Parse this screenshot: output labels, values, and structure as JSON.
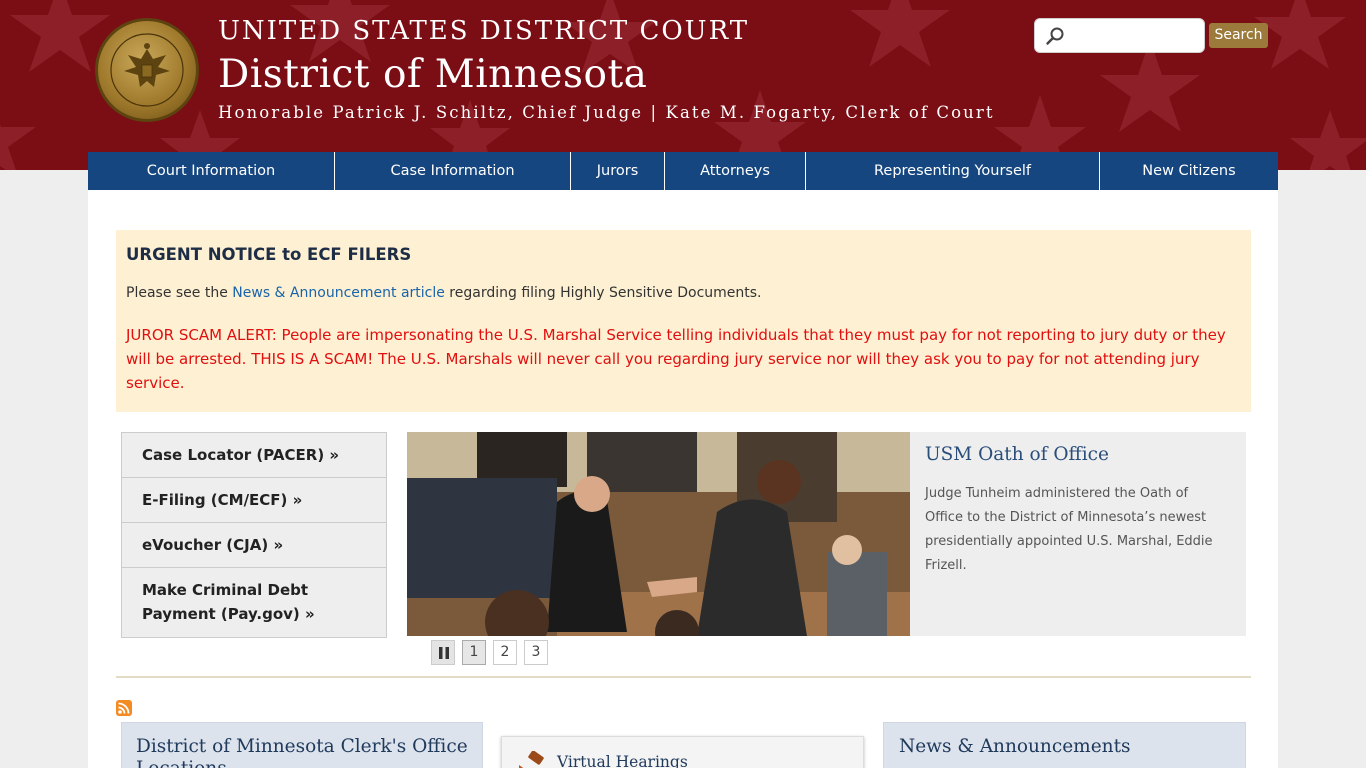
{
  "header": {
    "court_line": "UNITED STATES DISTRICT COURT",
    "district": "District of Minnesota",
    "officers": "Honorable Patrick J. Schiltz, Chief Judge | Kate M. Fogarty, Clerk of Court",
    "seal_text_top": "UNITED STATES DISTRICT COURT",
    "seal_text_bottom": "DISTRICT OF MINNESOTA",
    "background_color": "#7b0d15",
    "search": {
      "placeholder": "",
      "value": "",
      "button_label": "Search",
      "icon": "search-icon"
    }
  },
  "nav": {
    "items": [
      {
        "label": "Court Information"
      },
      {
        "label": "Case Information"
      },
      {
        "label": "Jurors"
      },
      {
        "label": "Attorneys"
      },
      {
        "label": "Representing Yourself"
      },
      {
        "label": "New Citizens"
      }
    ],
    "color": "#15467f"
  },
  "notice": {
    "title": "URGENT NOTICE to ECF FILERS",
    "text_before": "Please see the ",
    "link": "News & Announcement article",
    "text_after": " regarding filing Highly Sensitive Documents.",
    "alert": "JUROR SCAM ALERT: People are impersonating the U.S. Marshal Service telling individuals that they must pay for not reporting to jury duty or they will be arrested.  THIS IS A SCAM!  The U.S. Marshals will never call you regarding jury service nor will they ask you to pay for not attending jury service.",
    "alert_color": "#e10f0f"
  },
  "quick_links": [
    {
      "label": "Case Locator (PACER) »"
    },
    {
      "label": "E-Filing (CM/ECF) »"
    },
    {
      "label": "eVoucher (CJA) »"
    },
    {
      "label": "Make Criminal Debt Payment (Pay.gov) »"
    }
  ],
  "slideshow": {
    "title": "USM Oath of Office",
    "body": "Judge Tunheim administered the Oath of Office to the District of Minnesota’s newest presidentially appointed U.S. Marshal, Eddie Frizell.",
    "pages": [
      "1",
      "2",
      "3"
    ],
    "active_page": "1",
    "pause_icon": "pause-icon"
  },
  "bottom_boxes": {
    "clerk": {
      "title": "District of Minnesota Clerk's Office Locations"
    },
    "virtual": {
      "title": "Virtual Hearings",
      "icon": "gavel-icon"
    },
    "news": {
      "title": "News & Announcements"
    }
  },
  "rss_icon": "rss-icon"
}
